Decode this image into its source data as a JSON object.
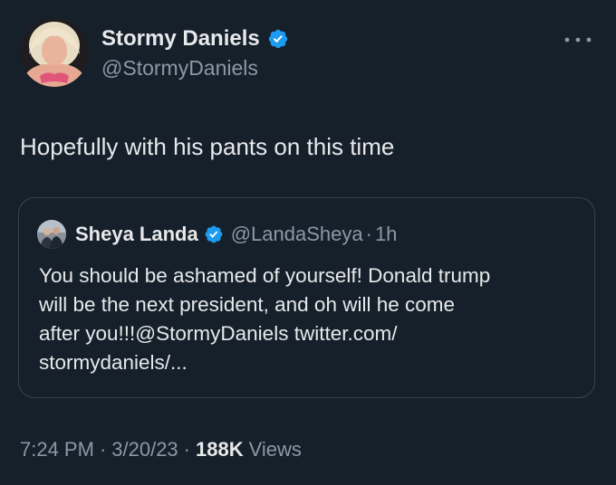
{
  "author": {
    "display_name": "Stormy Daniels",
    "handle": "@StormyDaniels",
    "verified_icon": "verified-badge-icon",
    "avatar_icon": "profile-photo"
  },
  "more_icon": "more-options-icon",
  "tweet": {
    "text": "Hopefully with his pants on this time"
  },
  "quote": {
    "display_name": "Sheya Landa",
    "handle": "@LandaSheya",
    "separator": "·",
    "time": "1h",
    "text_lines": [
      "You should be ashamed of yourself! Donald trump",
      "will be the next president,  and oh will he come",
      "after you!!!@StormyDaniels twitter.com/",
      "stormydaniels/..."
    ]
  },
  "meta": {
    "time": "7:24 PM",
    "sep1": "·",
    "date": "3/20/23",
    "sep2": "·",
    "views_count": "188K",
    "views_label": "Views"
  },
  "colors": {
    "background": "#15202b",
    "text_primary": "#e7e9ea",
    "text_secondary": "#8b98a5",
    "border": "#38444d",
    "verified": "#1d9bf0"
  }
}
